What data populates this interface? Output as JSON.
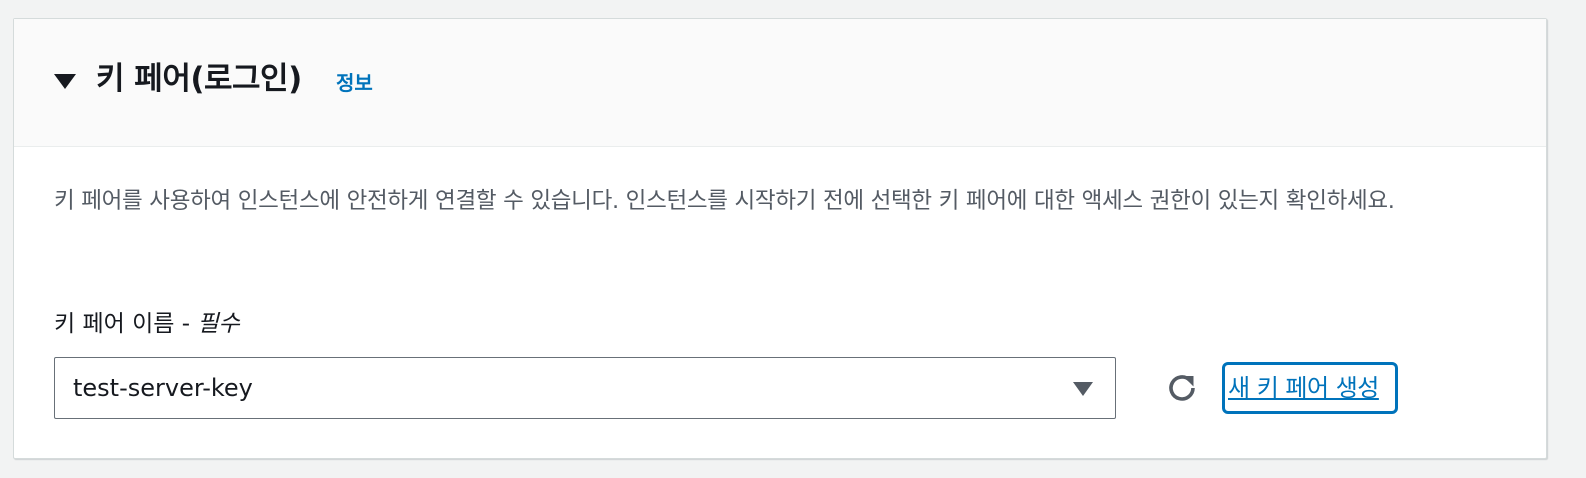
{
  "section": {
    "title": "키 페어(로그인)",
    "info_link": "정보",
    "expanded": true
  },
  "description": "키 페어를 사용하여 인스턴스에 안전하게 연결할 수 있습니다. 인스턴스를 시작하기 전에 선택한 키 페어에 대한 액세스 권한이 있는지 확인하세요.",
  "key_pair_field": {
    "label": "키 페어 이름 - ",
    "required_label": "필수",
    "selected_value": "test-server-key"
  },
  "actions": {
    "refresh_icon": "refresh-icon",
    "create_link": "새 키 페어 생성"
  },
  "colors": {
    "link": "#0073bb",
    "header_bg": "#fafafa",
    "page_bg": "#f2f3f3"
  }
}
